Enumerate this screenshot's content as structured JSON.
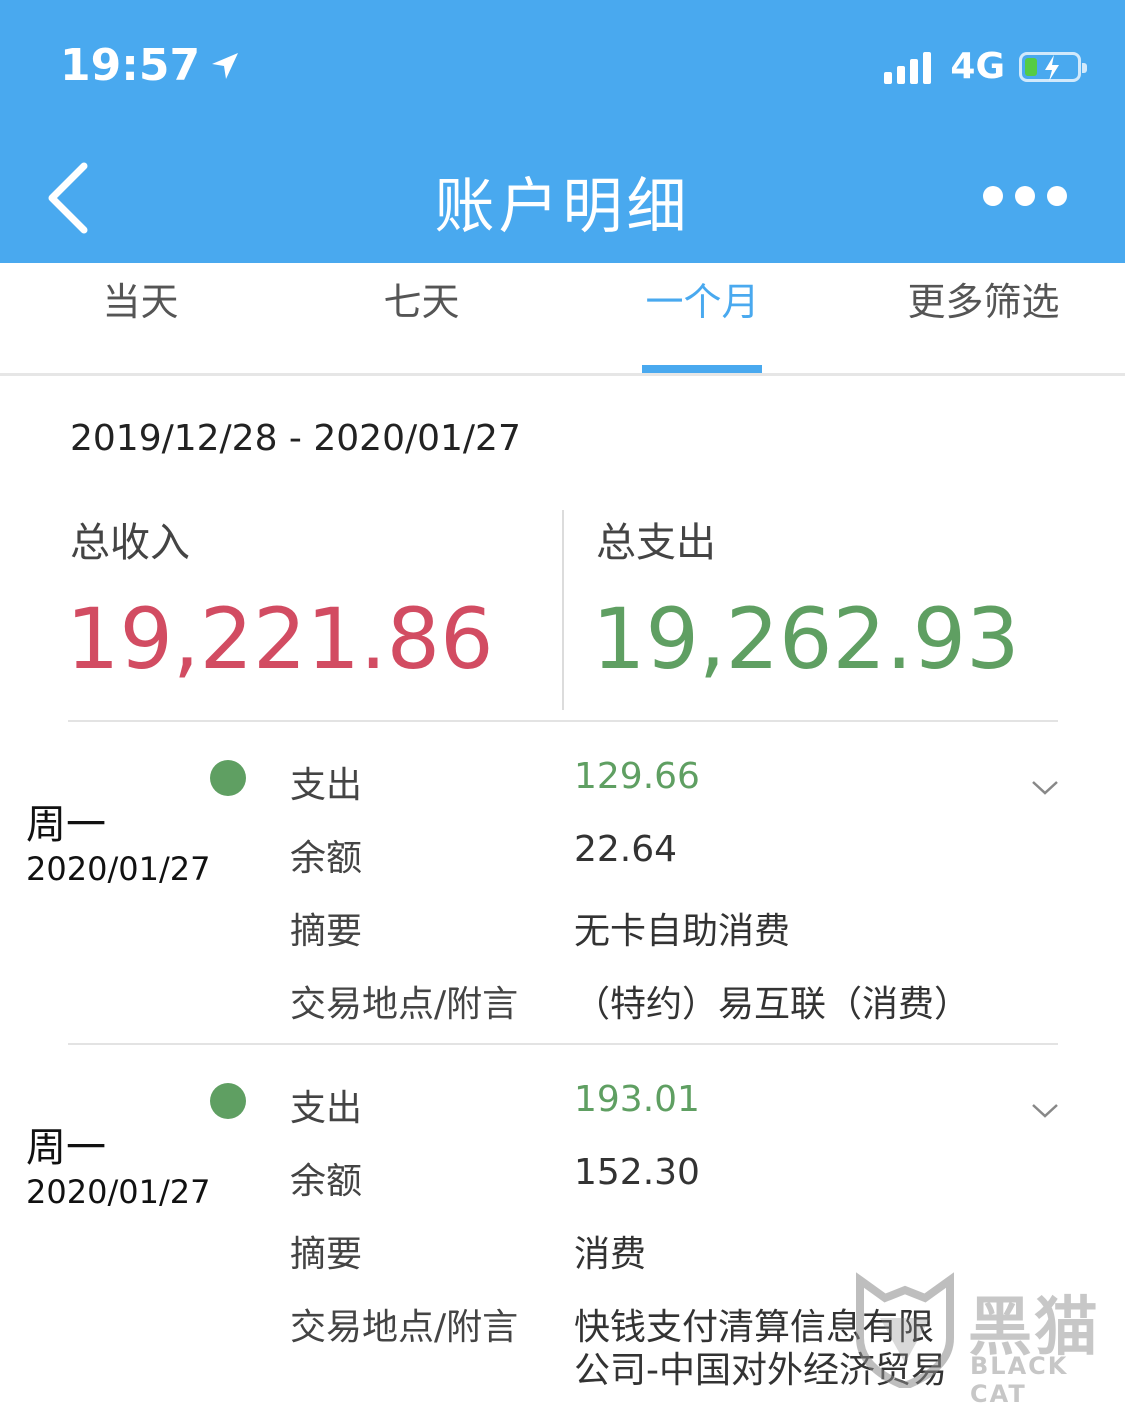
{
  "status_bar": {
    "time": "19:57",
    "network": "4G"
  },
  "nav": {
    "title": "账户明细"
  },
  "tabs": [
    {
      "label": "当天"
    },
    {
      "label": "七天"
    },
    {
      "label": "一个月"
    },
    {
      "label": "更多筛选"
    }
  ],
  "active_tab": "一个月",
  "summary": {
    "date_range": "2019/12/28 - 2020/01/27",
    "income_label": "总收入",
    "income_value": "19,221.86",
    "expense_label": "总支出",
    "expense_value": "19,262.93"
  },
  "records": [
    {
      "weekday": "周一",
      "date": "2020/01/27",
      "type_label": "支出",
      "amount": "129.66",
      "balance_label": "余额",
      "balance": "22.64",
      "summary_label": "摘要",
      "summary": "无卡自助消费",
      "location_label": "交易地点/附言",
      "location": "（特约）易互联（消费）"
    },
    {
      "weekday": "周一",
      "date": "2020/01/27",
      "type_label": "支出",
      "amount": "193.01",
      "balance_label": "余额",
      "balance": "152.30",
      "summary_label": "摘要",
      "summary": "消费",
      "location_label": "交易地点/附言",
      "location_line1": "快钱支付清算信息有限",
      "location_line2": "公司-中国对外经济贸易"
    }
  ],
  "watermark": {
    "cn": "黑猫",
    "en": "BLACK CAT"
  },
  "colors": {
    "header": "#49a9ef",
    "income": "#d24c62",
    "expense": "#5f9f62"
  }
}
